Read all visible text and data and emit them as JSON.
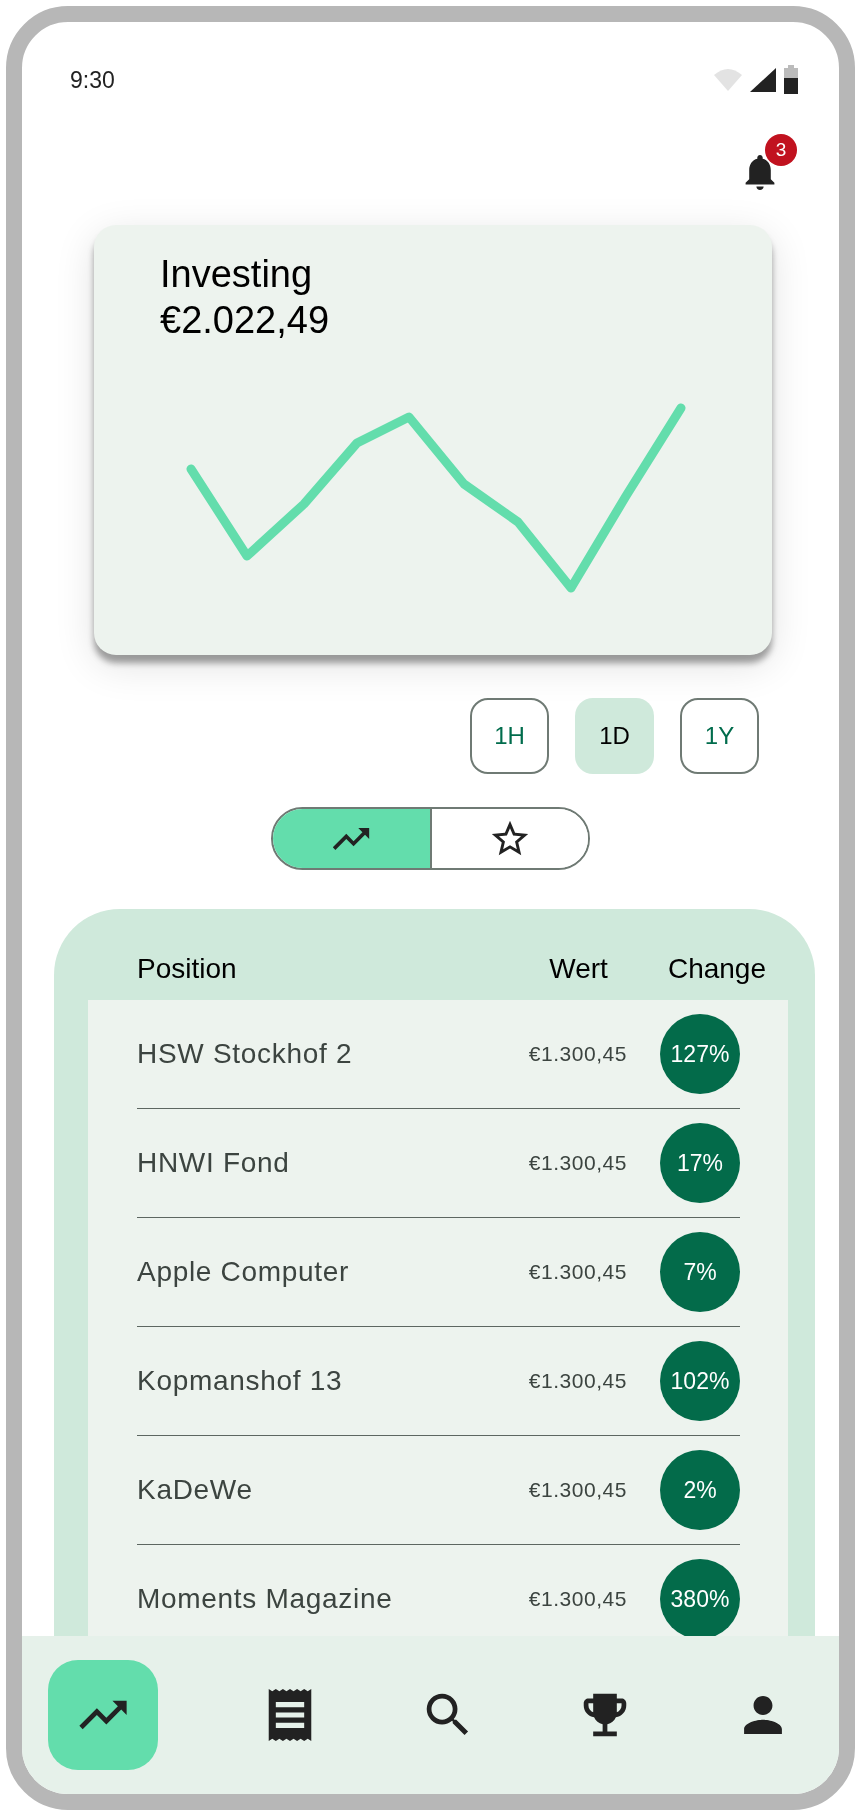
{
  "status_bar": {
    "time": "9:30"
  },
  "notifications": {
    "count": "3"
  },
  "portfolio_card": {
    "title": "Investing",
    "balance": "€2.022,49"
  },
  "range_buttons": [
    {
      "label": "1H",
      "selected": false
    },
    {
      "label": "1D",
      "selected": true
    },
    {
      "label": "1Y",
      "selected": false
    }
  ],
  "view_toggle": [
    {
      "kind": "trend",
      "selected": true
    },
    {
      "kind": "star",
      "selected": false
    }
  ],
  "positions_table": {
    "columns": [
      "Position",
      "Wert",
      "Change"
    ],
    "rows": [
      {
        "position": "HSW Stockhof 2",
        "wert": "€1.300,45",
        "change": "127%"
      },
      {
        "position": "HNWI Fond",
        "wert": "€1.300,45",
        "change": "17%"
      },
      {
        "position": "Apple Computer",
        "wert": "€1.300,45",
        "change": "7%"
      },
      {
        "position": "Kopmanshof 13",
        "wert": "€1.300,45",
        "change": "102%"
      },
      {
        "position": "KaDeWe",
        "wert": "€1.300,45",
        "change": "2%"
      },
      {
        "position": "Moments Magazine",
        "wert": "€1.300,45",
        "change": "380%"
      }
    ]
  },
  "bottom_nav": [
    {
      "kind": "trend",
      "selected": true
    },
    {
      "kind": "receipt",
      "selected": false
    },
    {
      "kind": "search",
      "selected": false
    },
    {
      "kind": "trophy",
      "selected": false
    },
    {
      "kind": "person",
      "selected": false
    }
  ]
}
